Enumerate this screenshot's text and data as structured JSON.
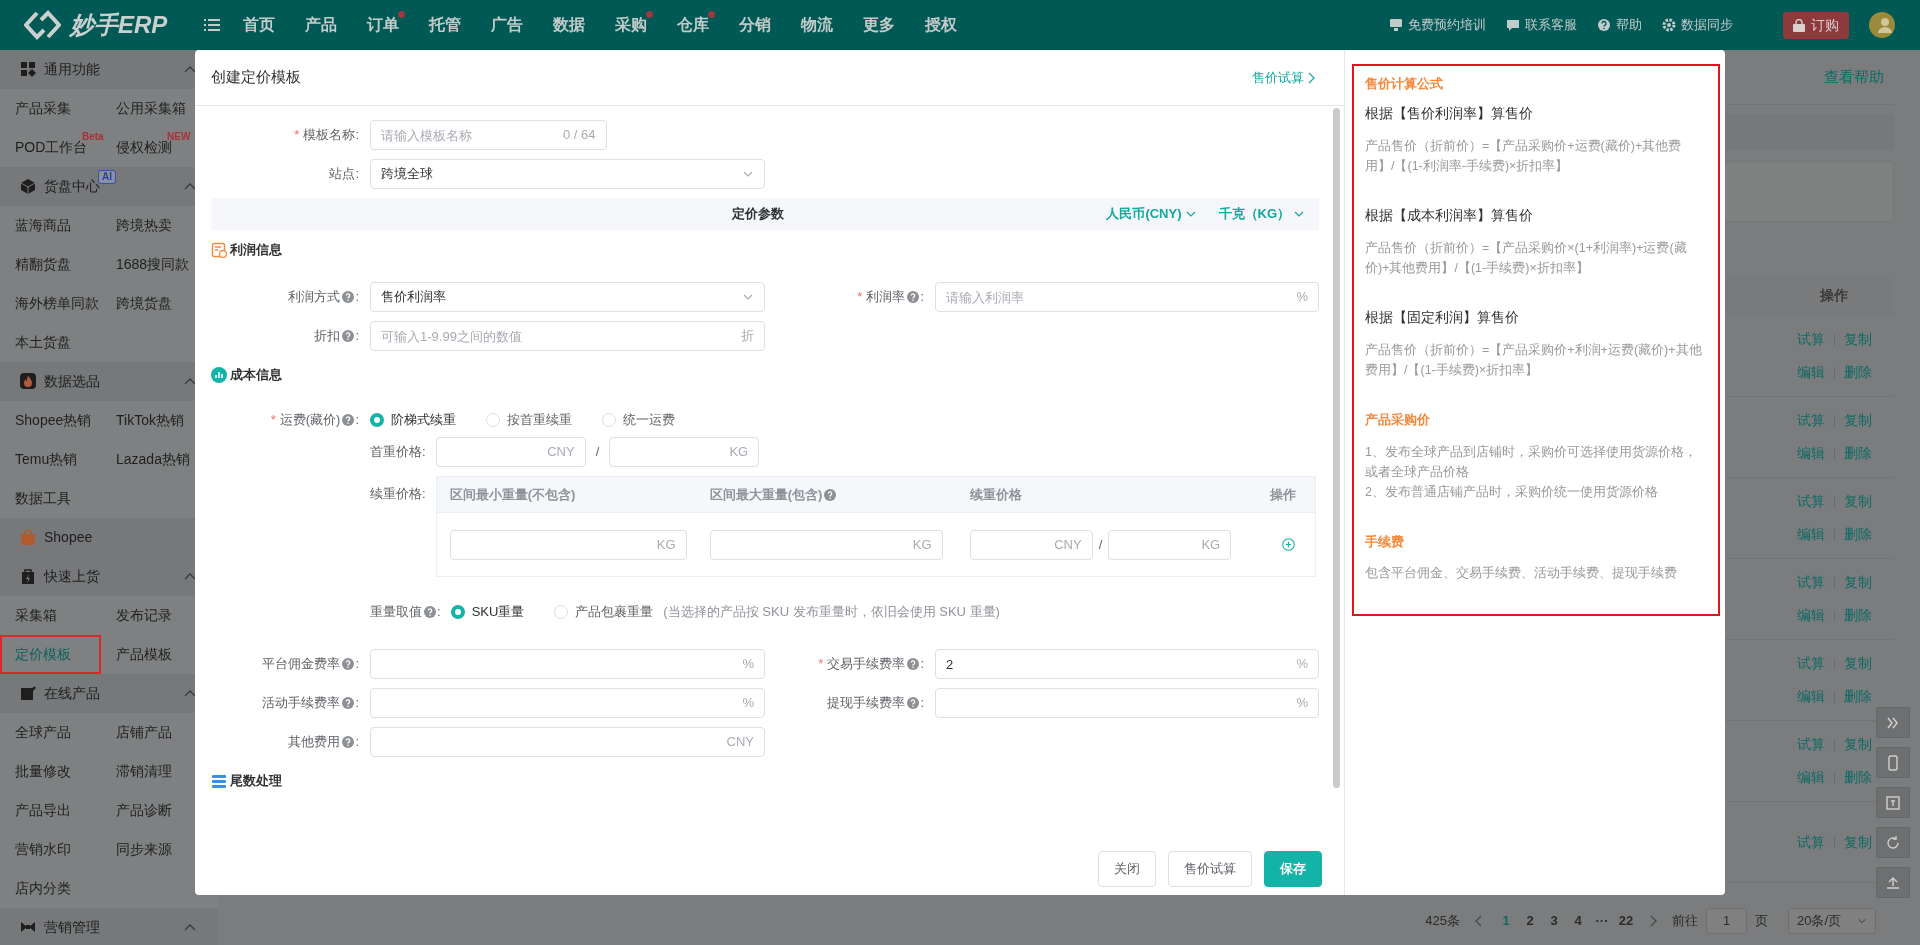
{
  "topbar": {
    "logo": "妙手ERP",
    "menu": [
      {
        "label": "首页",
        "dot": false
      },
      {
        "label": "产品",
        "dot": false
      },
      {
        "label": "订单",
        "dot": true
      },
      {
        "label": "托管",
        "dot": false
      },
      {
        "label": "广告",
        "dot": false
      },
      {
        "label": "数据",
        "dot": false
      },
      {
        "label": "采购",
        "dot": true
      },
      {
        "label": "仓库",
        "dot": true
      },
      {
        "label": "分销",
        "dot": false
      },
      {
        "label": "物流",
        "dot": false
      },
      {
        "label": "更多",
        "dot": false
      },
      {
        "label": "授权",
        "dot": false
      }
    ],
    "links": [
      "免费预约培训",
      "联系客服",
      "帮助",
      "数据同步"
    ],
    "order_button": "订购"
  },
  "sidebar": {
    "sections": [
      {
        "kind": "group",
        "title": "通用功能",
        "items": [
          {
            "label": "产品采集",
            "selected": false
          },
          {
            "label": "公用采集箱",
            "selected": false
          },
          {
            "label": "POD工作台",
            "badge": "Beta",
            "selected": false
          },
          {
            "label": "侵权检测",
            "badge": "NEW",
            "selected": false
          }
        ]
      },
      {
        "kind": "group",
        "title": "货盘中心",
        "badge": "AI",
        "items": [
          {
            "label": "蓝海商品",
            "selected": false
          },
          {
            "label": "跨境热卖",
            "selected": false
          },
          {
            "label": "精翻货盘",
            "selected": false
          },
          {
            "label": "1688搜同款",
            "selected": false
          },
          {
            "label": "海外榜单同款",
            "selected": false
          },
          {
            "label": "跨境货盘",
            "selected": false
          },
          {
            "label": "本土货盘",
            "selected": false
          }
        ]
      },
      {
        "kind": "group",
        "title": "数据选品",
        "items": [
          {
            "label": "Shopee热销",
            "selected": false
          },
          {
            "label": "TikTok热销",
            "selected": false
          },
          {
            "label": "Temu热销",
            "selected": false
          },
          {
            "label": "Lazada热销",
            "selected": false
          },
          {
            "label": "数据工具",
            "selected": false
          }
        ]
      },
      {
        "kind": "platform",
        "title": "Shopee"
      },
      {
        "kind": "group",
        "title": "快速上货",
        "items": [
          {
            "label": "采集箱",
            "selected": false
          },
          {
            "label": "发布记录",
            "selected": false
          },
          {
            "label": "定价模板",
            "selected": true
          },
          {
            "label": "产品模板",
            "selected": false
          }
        ]
      },
      {
        "kind": "group",
        "title": "在线产品",
        "items": [
          {
            "label": "全球产品",
            "selected": false
          },
          {
            "label": "店铺产品",
            "selected": false
          },
          {
            "label": "批量修改",
            "selected": false
          },
          {
            "label": "滞销清理",
            "selected": false
          },
          {
            "label": "产品导出",
            "selected": false
          },
          {
            "label": "产品诊断",
            "selected": false
          },
          {
            "label": "营销水印",
            "selected": false
          },
          {
            "label": "同步来源",
            "selected": false
          },
          {
            "label": "店内分类",
            "selected": false
          }
        ]
      },
      {
        "kind": "group",
        "title": "营销管理"
      }
    ]
  },
  "page": {
    "help_link": "查看帮助",
    "action_header": "操作",
    "rows": [
      {
        "actions": [
          [
            "试算",
            "复制"
          ],
          [
            "编辑",
            "删除"
          ]
        ]
      },
      {
        "actions": [
          [
            "试算",
            "复制"
          ],
          [
            "编辑",
            "删除"
          ]
        ]
      },
      {
        "actions": [
          [
            "试算",
            "复制"
          ],
          [
            "编辑",
            "删除"
          ]
        ]
      },
      {
        "actions": [
          [
            "试算",
            "复制"
          ],
          [
            "编辑",
            "删除"
          ]
        ]
      },
      {
        "actions": [
          [
            "试算",
            "复制"
          ],
          [
            "编辑",
            "删除"
          ]
        ]
      },
      {
        "actions": [
          [
            "试算",
            "复制"
          ],
          [
            "编辑",
            "删除"
          ]
        ]
      },
      {
        "actions": [
          [
            "试算",
            "复制"
          ]
        ]
      }
    ],
    "pagination": {
      "total": "425条",
      "pages": [
        {
          "label": "1",
          "selected": true
        },
        {
          "label": "2",
          "selected": false
        },
        {
          "label": "3",
          "selected": false
        },
        {
          "label": "4",
          "selected": false
        },
        {
          "label": "···",
          "selected": false
        },
        {
          "label": "22",
          "selected": false
        }
      ],
      "goto_label": "前往",
      "goto_value": "1",
      "goto_unit": "页",
      "page_size": "20条/页"
    }
  },
  "modal": {
    "title": "创建定价模板",
    "header_link": "售价试算",
    "form": {
      "rows": [
        {
          "kind": "fields",
          "fields": [
            {
              "label": "模板名称",
              "required_mark": "*",
              "colon": ":",
              "wide": true,
              "control": {
                "kind": "input",
                "placeholder": "请输入模板名称",
                "counter": "0 / 64"
              }
            }
          ]
        },
        {
          "kind": "fields",
          "fields": [
            {
              "label": "站点",
              "colon": ":",
              "control": {
                "kind": "select",
                "value": "跨境全球"
              }
            }
          ]
        },
        {
          "kind": "band",
          "title": "定价参数",
          "currency": "人民币(CNY)",
          "unit": "千克（KG）"
        },
        {
          "kind": "section",
          "title": "利润信息"
        },
        {
          "kind": "fields",
          "fields": [
            {
              "label": "利润方式",
              "help": true,
              "colon": ":",
              "control": {
                "kind": "select",
                "value": "售价利润率"
              }
            },
            {
              "label": "利润率",
              "required_mark": "*",
              "help": true,
              "colon": ":",
              "control": {
                "kind": "input",
                "placeholder": "请输入利润率",
                "suffix": "%"
              }
            }
          ]
        },
        {
          "kind": "fields",
          "fields": [
            {
              "label": "折扣",
              "help": true,
              "colon": ":",
              "control": {
                "kind": "input",
                "placeholder": "可输入1-9.99之间的数值",
                "suffix": "折"
              }
            }
          ]
        },
        {
          "kind": "section",
          "title": "成本信息"
        },
        {
          "kind": "radios",
          "label": "运费(藏价)",
          "required_mark": "*",
          "help": true,
          "colon": ":",
          "options": [
            {
              "label": "阶梯式续重",
              "selected": true
            },
            {
              "label": "按首重续重",
              "selected": false
            },
            {
              "label": "统一运费",
              "selected": false
            }
          ]
        },
        {
          "kind": "pair",
          "sub": true,
          "label": "首重价格",
          "colon": ":",
          "inputs": [
            {
              "suffix": "CNY"
            },
            {
              "suffix": "KG"
            }
          ],
          "separator": "/"
        },
        {
          "kind": "tiers",
          "sub": true,
          "label": "续重价格",
          "colon": ":",
          "columns": [
            {
              "label": "区间最小重量(不包含)",
              "help": false
            },
            {
              "label": "区间最大重量(包含)",
              "help": true
            },
            {
              "label": "续重价格",
              "help": false
            },
            {
              "label": "操作",
              "help": false
            }
          ],
          "inputs": [
            {
              "suffix": "KG"
            },
            {
              "suffix": "KG"
            },
            {
              "suffix": "CNY"
            },
            {
              "suffix": "KG"
            }
          ],
          "separator": "/"
        },
        {
          "kind": "radios",
          "sub": true,
          "label": "重量取值",
          "help": true,
          "colon": ":",
          "options": [
            {
              "label": "SKU重量",
              "selected": true
            },
            {
              "label": "产品包裹重量",
              "selected": false
            }
          ],
          "note": "(当选择的产品按 SKU 发布重量时，依旧会使用 SKU 重量)"
        },
        {
          "kind": "fields",
          "fields": [
            {
              "label": "平台佣金费率",
              "help": true,
              "colon": ":",
              "control": {
                "kind": "input",
                "suffix": "%"
              }
            },
            {
              "label": "交易手续费率",
              "required_mark": "*",
              "help": true,
              "colon": ":",
              "control": {
                "kind": "input",
                "value": "2",
                "suffix": "%"
              }
            }
          ]
        },
        {
          "kind": "fields",
          "fields": [
            {
              "label": "活动手续费率",
              "help": true,
              "colon": ":",
              "control": {
                "kind": "input",
                "suffix": "%"
              }
            },
            {
              "label": "提现手续费率",
              "help": true,
              "colon": ":",
              "control": {
                "kind": "input",
                "suffix": "%"
              }
            }
          ]
        },
        {
          "kind": "fields",
          "fields": [
            {
              "label": "其他费用",
              "help": true,
              "colon": ":",
              "control": {
                "kind": "input",
                "suffix": "CNY"
              }
            }
          ]
        },
        {
          "kind": "section",
          "title": "尾数处理"
        }
      ]
    },
    "buttons": [
      {
        "label": "关闭",
        "kind": "default"
      },
      {
        "label": "售价试算",
        "kind": "default"
      },
      {
        "label": "保存",
        "kind": "primary"
      }
    ],
    "formula_panel": {
      "title": "售价计算公式",
      "blocks": [
        {
          "kind": "formula",
          "heading": "根据【售价利润率】算售价",
          "lines": [
            "产品售价（折前价）=【产品采购价+运费(藏价)+其他费用】/【(1-利润率-手续费)×折扣率】"
          ]
        },
        {
          "kind": "formula",
          "heading": "根据【成本利润率】算售价",
          "lines": [
            "产品售价（折前价）=【产品采购价×(1+利润率)+运费(藏价)+其他费用】/【(1-手续费)×折扣率】"
          ]
        },
        {
          "kind": "formula",
          "heading": "根据【固定利润】算售价",
          "lines": [
            "产品售价（折前价）=【产品采购价+利润+运费(藏价)+其他费用】/【(1-手续费)×折扣率】"
          ]
        },
        {
          "kind": "note",
          "heading": "产品采购价",
          "lines": [
            "1、发布全球产品到店铺时，采购价可选择使用货源价格，或者全球产品价格",
            "2、发布普通店铺产品时，采购价统一使用货源价格"
          ]
        },
        {
          "kind": "note",
          "heading": "手续费",
          "lines": [
            "包含平台佣金、交易手续费、活动手续费、提现手续费"
          ]
        }
      ]
    }
  }
}
